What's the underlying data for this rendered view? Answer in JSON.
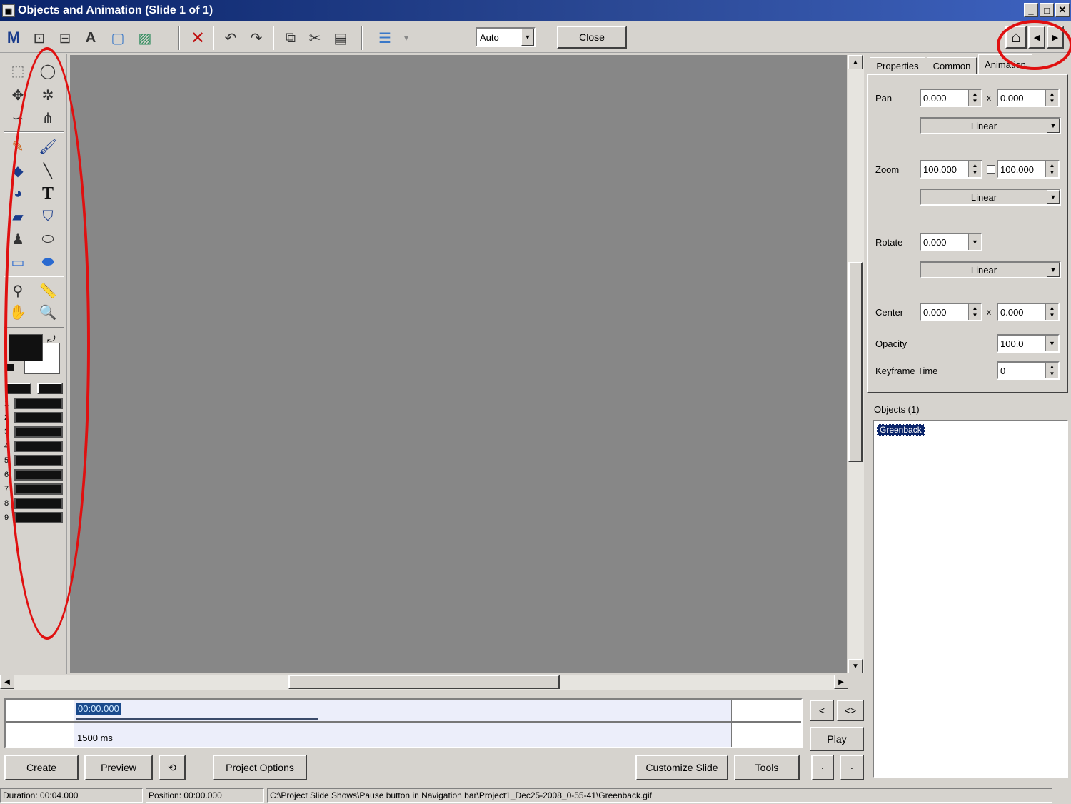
{
  "window": {
    "title": "Objects and Animation (Slide 1 of 1)",
    "app_icon": "image-app-icon",
    "buttons": [
      "_",
      "□",
      "✕"
    ]
  },
  "toolbar": {
    "zoom_value": "Auto",
    "close_label": "Close",
    "m_label": "M",
    "text_a": "A",
    "home_icon": "home-icon"
  },
  "tools": {
    "line_numbers": [
      "1",
      "2",
      "3",
      "4",
      "5",
      "6",
      "7",
      "8",
      "9"
    ],
    "text_tool": "T"
  },
  "right_panel": {
    "tabs": [
      "Properties",
      "Common",
      "Animation"
    ],
    "pan_label": "Pan",
    "pan_x": "0.000",
    "pan_y": "0.000",
    "pan_interp": "Linear",
    "zoom_label": "Zoom",
    "zoom_x": "100.000",
    "zoom_y": "100.000",
    "zoom_interp": "Linear",
    "rotate_label": "Rotate",
    "rotate_value": "0.000",
    "rotate_interp": "Linear",
    "center_label": "Center",
    "center_x": "0.000",
    "center_y": "0.000",
    "opacity_label": "Opacity",
    "opacity_value": "100.0",
    "keyframe_label": "Keyframe Time",
    "keyframe_value": "0",
    "x_sep": "x"
  },
  "objects": {
    "header": "Objects (1)",
    "items": [
      "Greenback"
    ]
  },
  "timeline": {
    "time_marker": "00:00.000",
    "duration_marker": "1500 ms",
    "play_label": "Play",
    "prev_label": "<",
    "nav_label": "<>"
  },
  "bottom_buttons": {
    "create": "Create",
    "preview": "Preview",
    "project_options": "Project Options",
    "customize_slide": "Customize Slide",
    "tools": "Tools",
    "small_a": "·",
    "small_b": "·"
  },
  "status": {
    "duration_label": "Duration:",
    "duration_value": "00:04.000",
    "position_label": "Position:",
    "position_value": "00:00.000",
    "path": "C:\\Project Slide Shows\\Pause button in Navigation bar\\Project1_Dec25-2008_0-55-41\\Greenback.gif"
  },
  "colors": {
    "canvas": "#878787",
    "titlebar": "#0a246a",
    "annotation": "#e01010",
    "selection": "#0a246a"
  }
}
